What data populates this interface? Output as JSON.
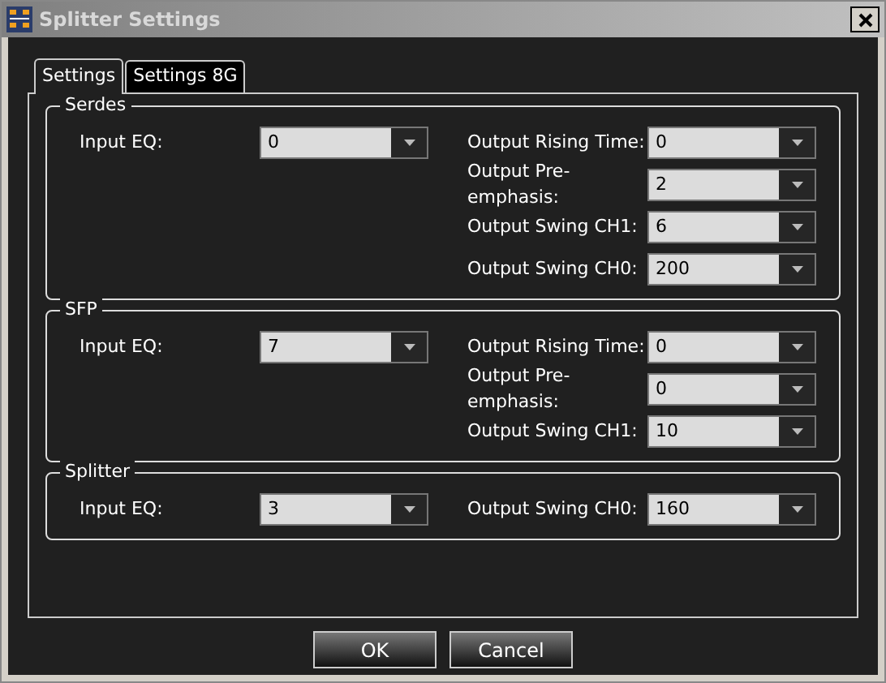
{
  "window": {
    "title": "Splitter Settings"
  },
  "tabs": [
    {
      "label": "Settings",
      "selected": true
    },
    {
      "label": "Settings 8G",
      "selected": false
    }
  ],
  "groups": [
    {
      "title": "Serdes",
      "left": [
        {
          "label": "Input EQ:",
          "value": "0"
        }
      ],
      "right": [
        {
          "label": "Output Rising Time:",
          "value": "0"
        },
        {
          "label": "Output Pre-emphasis:",
          "value": "2"
        },
        {
          "label": "Output Swing CH1:",
          "value": "6"
        },
        {
          "label": "Output Swing CH0:",
          "value": "200"
        }
      ]
    },
    {
      "title": "SFP",
      "left": [
        {
          "label": "Input EQ:",
          "value": "7"
        }
      ],
      "right": [
        {
          "label": "Output Rising Time:",
          "value": "0"
        },
        {
          "label": "Output Pre-emphasis:",
          "value": "0"
        },
        {
          "label": "Output Swing CH1:",
          "value": "10"
        }
      ]
    },
    {
      "title": "Splitter",
      "left": [
        {
          "label": "Input EQ:",
          "value": "3"
        }
      ],
      "right": [
        {
          "label": "Output Swing CH0:",
          "value": "160"
        }
      ]
    }
  ],
  "buttons": [
    "OK",
    "Cancel"
  ]
}
